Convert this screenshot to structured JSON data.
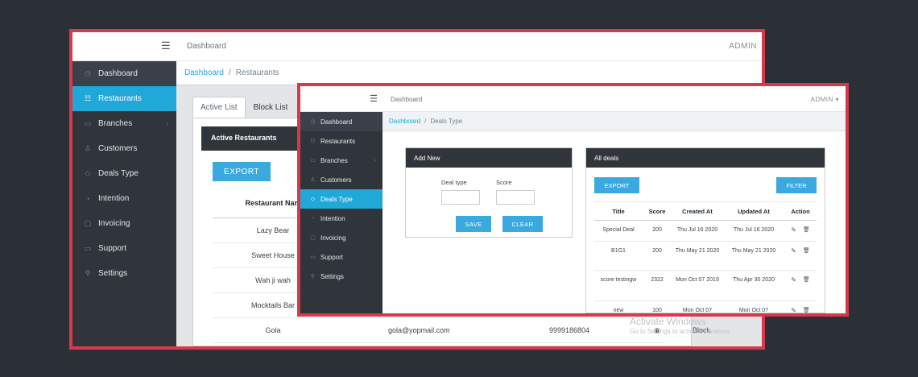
{
  "back": {
    "header": {
      "menu_icon": "☰",
      "title": "Dashboard",
      "user": "ADMIN"
    },
    "sidebar": {
      "items": [
        {
          "label": "Dashboard",
          "icon": "speedometer-icon",
          "glyph": "◷"
        },
        {
          "label": "Restaurants",
          "icon": "list-icon",
          "glyph": "☷"
        },
        {
          "label": "Branches",
          "icon": "folder-icon",
          "glyph": "▭"
        },
        {
          "label": "Customers",
          "icon": "user-icon",
          "glyph": "♙"
        },
        {
          "label": "Deals Type",
          "icon": "diamond-icon",
          "glyph": "◇"
        },
        {
          "label": "Intention",
          "icon": "clock-icon",
          "glyph": "◔"
        },
        {
          "label": "Invoicing",
          "icon": "doc-icon",
          "glyph": "▢"
        },
        {
          "label": "Support",
          "icon": "chat-icon",
          "glyph": "▭"
        },
        {
          "label": "Settings",
          "icon": "wrench-icon",
          "glyph": "⚲"
        }
      ]
    },
    "breadcrumb": {
      "home": "Dashboard",
      "current": "Restaurants"
    },
    "tabs": {
      "active": "Active List",
      "inactive": "Block List"
    },
    "panel": {
      "title": "Active Restaurants",
      "export": "EXPORT",
      "col_header": "Restaurant Nam",
      "rows": [
        {
          "name": "Lazy Bear"
        },
        {
          "name": "Sweet House"
        },
        {
          "name": "Wah ji wah"
        },
        {
          "name": "Mocktails Bar"
        },
        {
          "name": "Gola",
          "email": "gola@yopmail.com",
          "phone": "9999186804",
          "action": "Block"
        }
      ]
    },
    "watermark": {
      "title": "Activate Windows",
      "sub": "Go to Settings to activate Windows."
    }
  },
  "front": {
    "header": {
      "menu_icon": "☰",
      "title": "Dashboard",
      "user": "ADMIN ▾"
    },
    "sidebar": {
      "items": [
        {
          "label": "Dashboard",
          "icon": "speedometer-icon",
          "glyph": "◷"
        },
        {
          "label": "Restaurants",
          "icon": "list-icon",
          "glyph": "☷"
        },
        {
          "label": "Branches",
          "icon": "folder-icon",
          "glyph": "▭"
        },
        {
          "label": "Customers",
          "icon": "user-icon",
          "glyph": "♙"
        },
        {
          "label": "Deals Type",
          "icon": "diamond-icon",
          "glyph": "◇"
        },
        {
          "label": "Intention",
          "icon": "clock-icon",
          "glyph": "◔"
        },
        {
          "label": "Invoicing",
          "icon": "doc-icon",
          "glyph": "▢"
        },
        {
          "label": "Support",
          "icon": "chat-icon",
          "glyph": "▭"
        },
        {
          "label": "Settings",
          "icon": "wrench-icon",
          "glyph": "⚲"
        }
      ]
    },
    "breadcrumb": {
      "home": "Dashboard",
      "current": "Deals Type"
    },
    "add_new": {
      "title": "Add New",
      "deal_type_label": "Deal type",
      "score_label": "Score",
      "deal_type_value": "",
      "score_value": "",
      "save": "SAVE",
      "clear": "CLEAR"
    },
    "all_deals": {
      "title": "All deals",
      "export": "EXPORT",
      "filter": "FILTER",
      "columns": [
        "Title",
        "Score",
        "Created At",
        "Updated At",
        "Action"
      ],
      "rows": [
        {
          "title": "Special Deal",
          "score": "200",
          "created": "Thu Jul 16 2020",
          "updated": "Thu Jul 16 2020"
        },
        {
          "title": "B1G1",
          "score": "200",
          "created": "Thu May 21 2020",
          "updated": "Thu May 21 2020"
        },
        {
          "title": "score testingw",
          "score": "2322",
          "created": "Mon Oct 07 2019",
          "updated": "Thu Apr 30 2020"
        },
        {
          "title": "new",
          "score": "100",
          "created": "Mon Oct 07",
          "updated": "Mon Oct 07"
        }
      ]
    }
  },
  "colors": {
    "accent": "#20a8d8",
    "sidebar": "#2f353a",
    "frame": "#d7394b",
    "background": "#2b3036"
  }
}
